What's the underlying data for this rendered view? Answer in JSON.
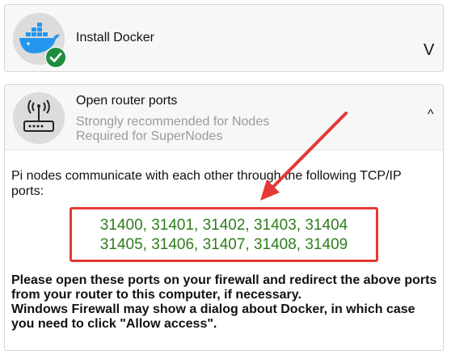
{
  "steps": [
    {
      "title": "Install Docker",
      "toggle": "V",
      "icon": "docker-whale-icon",
      "status_icon": "checkmark-icon",
      "status_color": "#1e8e3e"
    },
    {
      "title": "Open router ports",
      "subtitle_1": "Strongly recommended for Nodes",
      "subtitle_2": "Required for SuperNodes",
      "toggle": "^",
      "icon": "router-icon"
    }
  ],
  "router_ports": {
    "intro": "Pi nodes communicate with each other through the following TCP/IP ports:",
    "ports_line_1": "31400, 31401, 31402, 31403, 31404",
    "ports_line_2": "31405, 31406, 31407, 31408, 31409",
    "instruction_line_1": "Please open these ports on your firewall and redirect the above ports",
    "instruction_line_2": "from your router to this computer, if necessary.",
    "instruction_line_3": "Windows Firewall may show a dialog about Docker, in which case",
    "instruction_line_4": "you need to click \"Allow access\"."
  },
  "colors": {
    "port_text": "#2e7d1c",
    "highlight_border": "#e53935",
    "annotation_arrow": "#e53935",
    "docker_blue": "#2496ed"
  }
}
